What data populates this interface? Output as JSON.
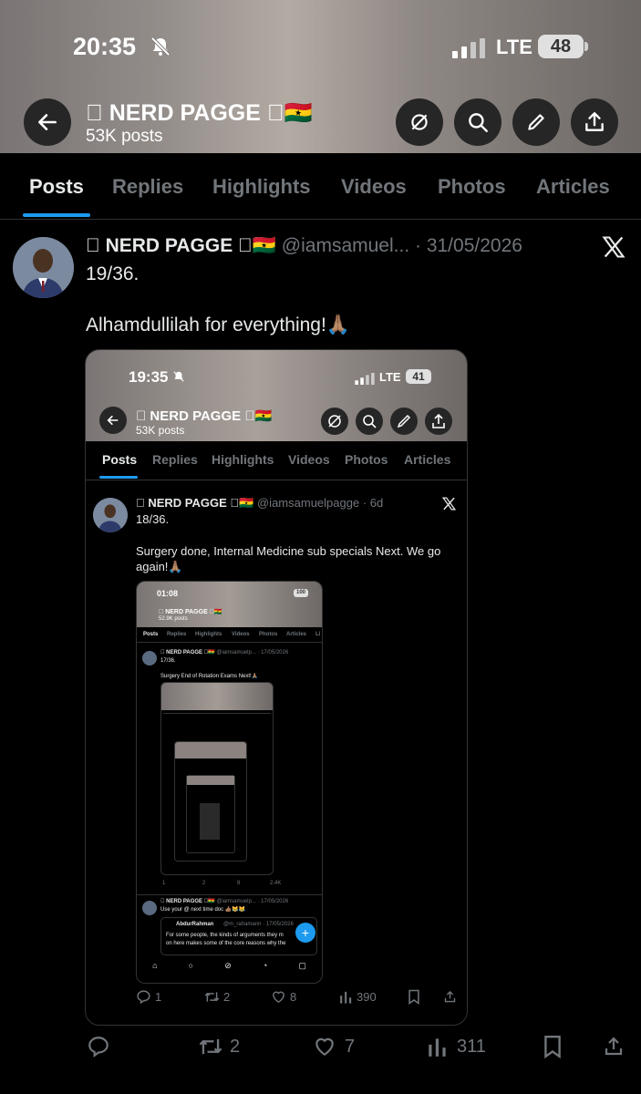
{
  "status": {
    "time": "20:35",
    "network": "LTE",
    "battery": "48"
  },
  "header": {
    "account_name": " NERD PAGGE 🇬🇭",
    "post_count": "53K posts"
  },
  "tabs": [
    {
      "label": "Posts"
    },
    {
      "label": "Replies"
    },
    {
      "label": "Highlights"
    },
    {
      "label": "Videos"
    },
    {
      "label": "Photos"
    },
    {
      "label": "Articles"
    }
  ],
  "post": {
    "author": " NERD PAGGE 🇬🇭",
    "handle": "@iamsamuel...",
    "date": "· 31/05/2026",
    "line1": "19/36.",
    "line2": "Alhamdullilah for everything!🙏🏽",
    "actions": {
      "replies": "",
      "reposts": "2",
      "likes": "7",
      "views": "311"
    }
  },
  "embed1": {
    "time": "19:35",
    "network": "LTE",
    "battery": "41",
    "account_name": " NERD PAGGE 🇬🇭",
    "post_count": "53K posts",
    "tabs": [
      "Posts",
      "Replies",
      "Highlights",
      "Videos",
      "Photos",
      "Articles"
    ],
    "author": " NERD PAGGE 🇬🇭",
    "handle": "@iamsamuelpagge",
    "date": "· 6d",
    "line1": "18/36.",
    "line2": "Surgery done, Internal Medicine sub specials Next. We go",
    "line3": "again!🙏🏽",
    "actions": {
      "replies": "1",
      "reposts": "2",
      "likes": "8",
      "views": "390"
    }
  },
  "embed2": {
    "time": "01:08",
    "battery": "100",
    "account_name": " NERD PAGGE 🇬🇭",
    "post_count": "52.9K posts",
    "tabs": [
      "Posts",
      "Replies",
      "Highlights",
      "Videos",
      "Photos",
      "Articles",
      "Li"
    ],
    "author": " NERD PAGGE 🇬🇭",
    "handle": "@iamsamuelp...",
    "date": "· 17/05/2026",
    "line1": "17/36.",
    "line2": "Surgery End of Rotation Exams Next!🙏🏽",
    "actions": {
      "replies": "1",
      "reposts": "2",
      "likes": "8",
      "views": "2.4K"
    },
    "reply_author": " NERD PAGGE 🇬🇭",
    "reply_handle": "@iamsamuelp...",
    "reply_date": "· 17/05/2026",
    "reply_text": "Use your @ next time doc 👍🏽😹😹",
    "quote_author": "AbdurRahman",
    "quote_handle": "@m_rahamann · 17/05/2026",
    "quote_line1": "For some people, the kinds of arguments they m",
    "quote_line2": "on here makes some of the core reasons why the"
  },
  "colors": {
    "accent": "#1d9bf0",
    "background": "#000000",
    "muted": "#71767b",
    "text": "#e7e9ea"
  }
}
